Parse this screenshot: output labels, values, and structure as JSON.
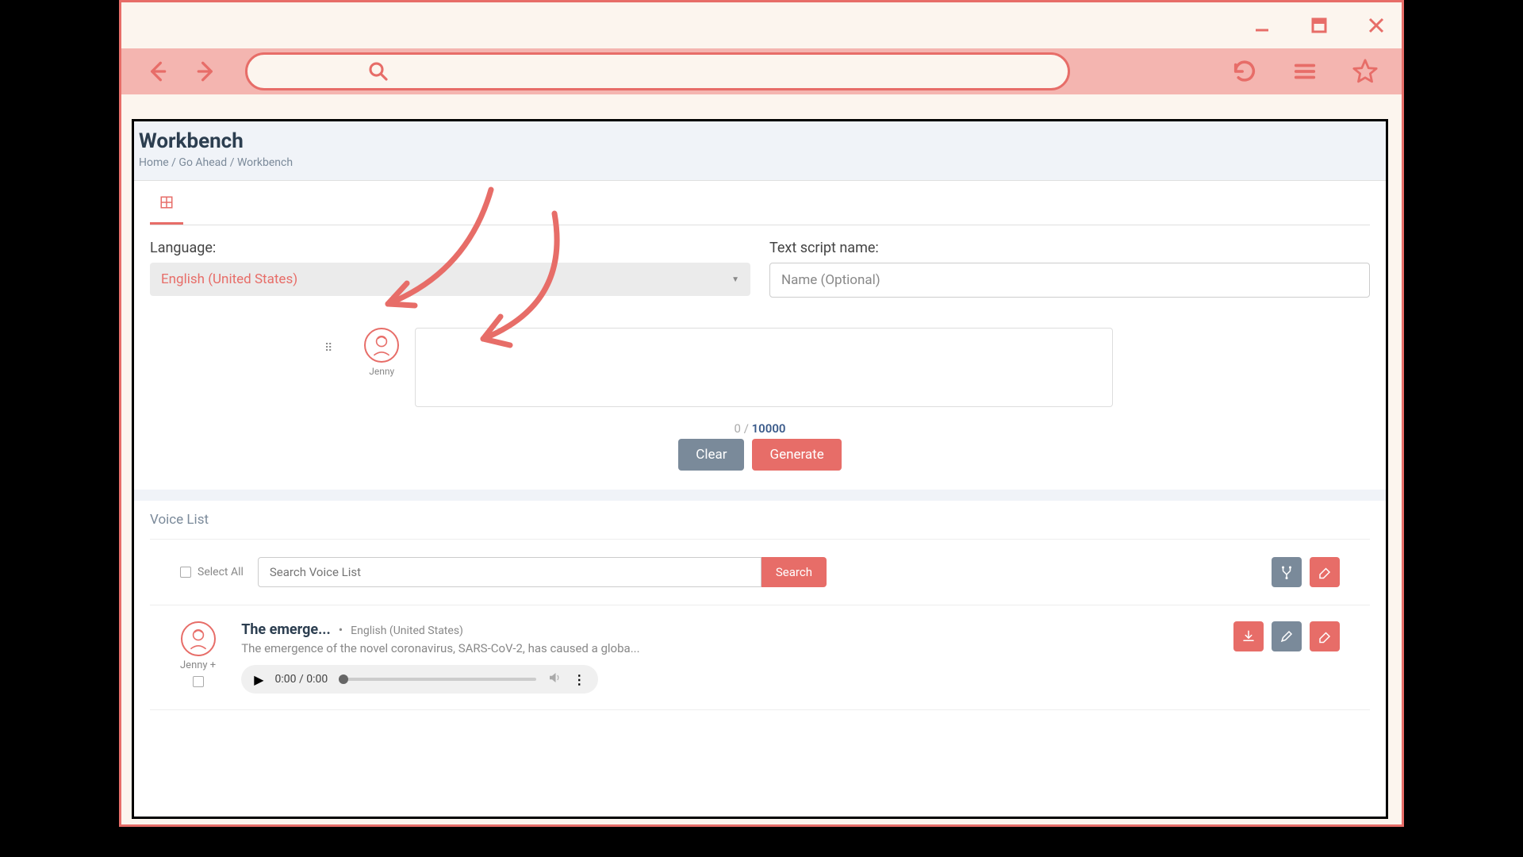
{
  "page": {
    "title": "Workbench",
    "breadcrumb": {
      "home": "Home",
      "goahead": "Go Ahead",
      "current": "Workbench"
    }
  },
  "form": {
    "languageLabel": "Language:",
    "languageValue": "English (United States)",
    "scriptNameLabel": "Text script name:",
    "scriptNamePlaceholder": "Name (Optional)",
    "speakerName": "Jenny",
    "counterCurrent": "0",
    "counterMax": "10000",
    "clearLabel": "Clear",
    "generateLabel": "Generate"
  },
  "voiceList": {
    "header": "Voice List",
    "selectAllLabel": "Select All",
    "searchPlaceholder": "Search Voice List",
    "searchButton": "Search"
  },
  "voiceItem": {
    "title": "The emerge...",
    "lang": "English (United States)",
    "desc": "The emergence of the novel coronavirus, SARS-CoV-2, has caused a globa...",
    "speakerName": "Jenny +",
    "time": "0:00 / 0:00"
  }
}
